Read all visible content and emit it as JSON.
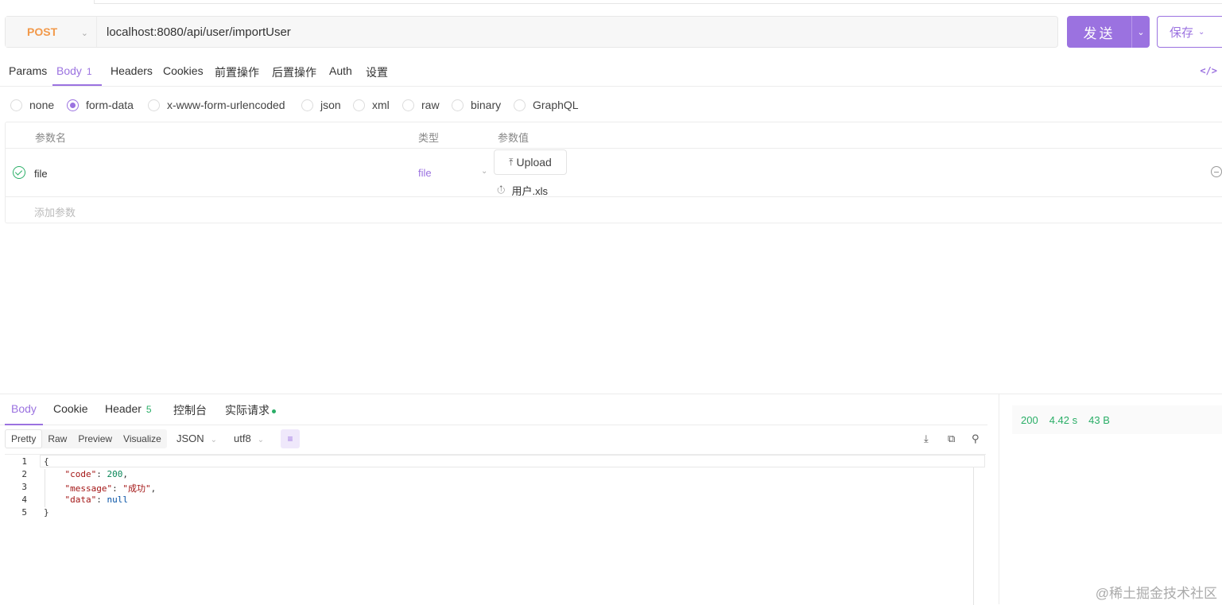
{
  "request": {
    "method": "POST",
    "url": "localhost:8080/api/user/importUser",
    "send_label": "发送",
    "save_label": "保存"
  },
  "req_tabs": [
    {
      "label": "Params"
    },
    {
      "label": "Body",
      "badge": "1"
    },
    {
      "label": "Headers"
    },
    {
      "label": "Cookies"
    },
    {
      "label": "前置操作"
    },
    {
      "label": "后置操作"
    },
    {
      "label": "Auth"
    },
    {
      "label": "设置"
    }
  ],
  "body_types": [
    "none",
    "form-data",
    "x-www-form-urlencoded",
    "json",
    "xml",
    "raw",
    "binary",
    "GraphQL"
  ],
  "body_type_selected": "form-data",
  "params_table": {
    "headers": [
      "参数名",
      "类型",
      "参数值"
    ],
    "rows": [
      {
        "name": "file",
        "type": "file",
        "upload_label": "Upload",
        "file_name": "用户.xls"
      }
    ],
    "add_placeholder": "添加参数"
  },
  "resp_tabs": [
    {
      "label": "Body"
    },
    {
      "label": "Cookie"
    },
    {
      "label": "Header",
      "badge": "5"
    },
    {
      "label": "控制台"
    },
    {
      "label": "实际请求"
    }
  ],
  "formats": [
    "Pretty",
    "Raw",
    "Preview",
    "Visualize"
  ],
  "format_selected": "Pretty",
  "language": "JSON",
  "encoding": "utf8",
  "response_lines": [
    "1",
    "2",
    "3",
    "4",
    "5"
  ],
  "response_body": {
    "open": "{",
    "code_key": "\"code\"",
    "code_val": "200",
    "message_key": "\"message\"",
    "message_val": "\"成功\"",
    "data_key": "\"data\"",
    "data_val": "null",
    "close": "}"
  },
  "status": {
    "code": "200",
    "time": "4.42 s",
    "size": "43 B"
  },
  "watermark": "@稀土掘金技术社区",
  "colors": {
    "accent": "#9b72e0",
    "method_post": "#f2994a",
    "success": "#2aae67"
  }
}
